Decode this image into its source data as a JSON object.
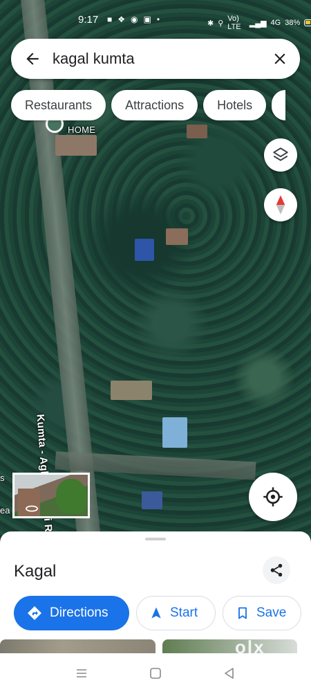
{
  "status_bar": {
    "time": "9:17",
    "battery_percent": "38%",
    "network": "Vo) LTE",
    "network2": "4G"
  },
  "search": {
    "query": "kagal kumta"
  },
  "chips": [
    "Restaurants",
    "Attractions",
    "Hotels"
  ],
  "map": {
    "road_label": "Kumta - Aghanashini Ro",
    "home_label": "HOME",
    "edge_label_1": "s",
    "edge_label_2": "ea"
  },
  "place": {
    "title": "Kagal"
  },
  "actions": {
    "directions": "Directions",
    "start": "Start",
    "save": "Save"
  },
  "watermark": "olx",
  "colors": {
    "accent": "#1a73e8",
    "compass_red": "#e53935"
  }
}
